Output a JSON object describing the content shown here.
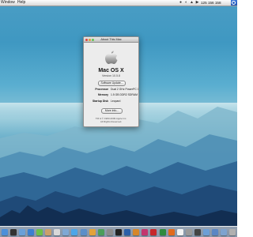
{
  "menubar": {
    "menus": [
      "Window",
      "Help"
    ],
    "clock": "125  156  158"
  },
  "about_window": {
    "title": "About This Mac",
    "os_name": "Mac OS X",
    "version": "Version 10.5.8",
    "software_update_label": "Software Update...",
    "processor_label": "Processor",
    "processor_value": "Dual 2 GHz PowerPC G5",
    "memory_label": "Memory",
    "memory_value": "1.5 GB DDR2 SDRAM",
    "startup_label": "Startup Disk",
    "startup_value": "Leopard",
    "more_info_label": "More Info...",
    "copyright_line1": "TM & © 1983-2009 Apple Inc.",
    "copyright_line2": "All Rights Reserved."
  },
  "colors": {
    "close": "#e0443e",
    "minimize": "#dea236",
    "zoom": "#62c554"
  },
  "dock": {
    "icons": [
      "finder-icon",
      "dashboard-icon",
      "mail-icon",
      "safari-icon",
      "ichat-icon",
      "address-book-icon",
      "ical-icon",
      "preview-icon",
      "itunes-icon",
      "iphoto-icon",
      "garageband-icon",
      "time-machine-icon",
      "system-preferences-icon",
      "terminal-icon",
      "photoshop-icon",
      "illustrator-icon",
      "indesign-icon",
      "flash-icon",
      "dreamweaver-icon",
      "firefox-icon",
      "textedit-icon",
      "calculator-icon",
      "activity-monitor-icon",
      "downloads-icon",
      "applications-icon",
      "documents-icon",
      "trash-icon"
    ]
  }
}
